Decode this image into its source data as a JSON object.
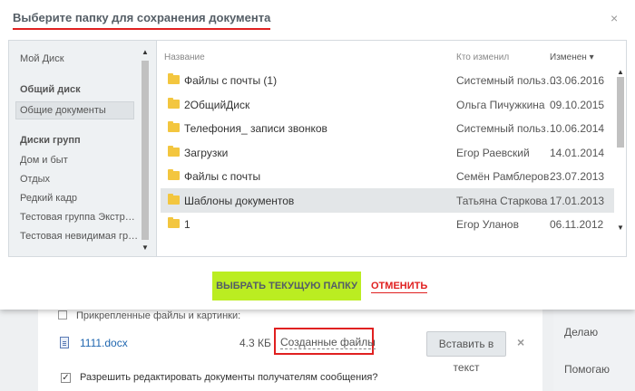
{
  "modal": {
    "title": "Выберите папку для сохранения документа",
    "close_glyph": "×",
    "select_button_label": "ВЫБРАТЬ ТЕКУЩУЮ ПАПКУ",
    "cancel_button_label": "ОТМЕНИТЬ"
  },
  "sidebar": {
    "my_disk": "Мой Диск",
    "common_disk_header": "Общий диск",
    "common_docs": "Общие документы",
    "group_disks_header": "Диски групп",
    "groups": [
      "Дом и быт",
      "Отдых",
      "Редкий кадр",
      "Тестовая группа Экстр…",
      "Тестовая невидимая гр…"
    ]
  },
  "columns": {
    "name": "Название",
    "modified_by": "Кто изменил",
    "modified": "Изменен",
    "sort_glyph": "▾"
  },
  "files": [
    {
      "name": "Файлы с почты (1)",
      "who": "Системный польз…",
      "date": "03.06.2016"
    },
    {
      "name": "2ОбщийДиск",
      "who": "Ольга Пичужкина",
      "date": "09.10.2015"
    },
    {
      "name": "Телефония_ записи звонков",
      "who": "Системный польз…",
      "date": "10.06.2014"
    },
    {
      "name": "Загрузки",
      "who": "Егор Раевский",
      "date": "14.01.2014"
    },
    {
      "name": "Файлы с почты",
      "who": "Семён Рамблеров",
      "date": "23.07.2013"
    },
    {
      "name": "Шаблоны документов",
      "who": "Татьяна Старкова",
      "date": "17.01.2013",
      "selected": true
    },
    {
      "name": "1",
      "who": "Егор Уланов",
      "date": "06.11.2012"
    }
  ],
  "background": {
    "attachments_title": "Прикрепленные файлы и картинки:",
    "file_name": "1111.docx",
    "file_size": "4.3 КБ",
    "created_files_link": "Созданные файлы",
    "insert_button": "Вставить в текст",
    "remove_glyph": "×",
    "checkbox_label": "Разрешить редактировать документы получателям сообщения?",
    "checkbox_checked": true,
    "side_items": [
      "Делаю",
      "Помогаю"
    ]
  },
  "colors": {
    "accent_red": "#e02020",
    "select_button": "#bbed21",
    "folder": "#f3c63f"
  }
}
